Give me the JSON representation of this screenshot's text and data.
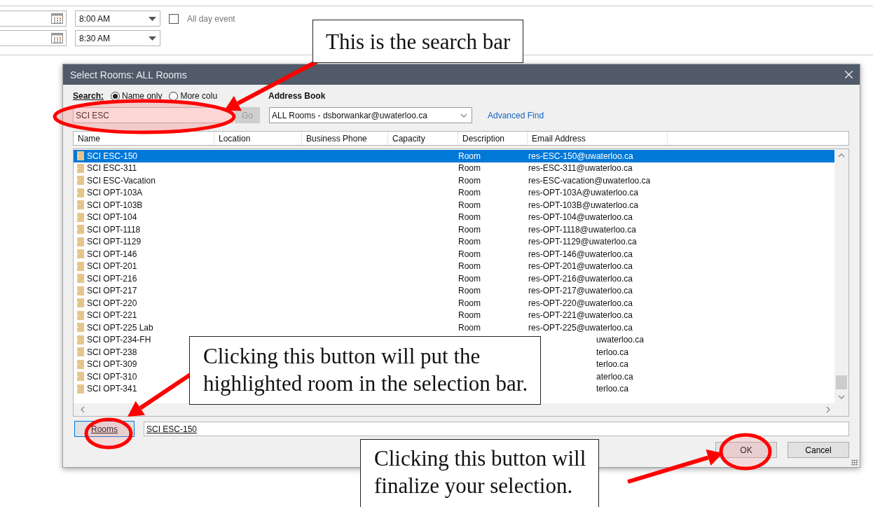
{
  "appointment": {
    "rows": [
      {
        "time": "8:00 AM",
        "all_day": {
          "label": "All day event",
          "checked": false
        }
      },
      {
        "time": "8:30 AM"
      }
    ]
  },
  "dialog": {
    "title": "Select Rooms: ALL Rooms",
    "search_label": "Search:",
    "search_modes": [
      {
        "label": "Name only",
        "selected": true
      },
      {
        "label": "More colu",
        "selected": false
      }
    ],
    "search_field": {
      "value": "SCI ESC"
    },
    "go_button": {
      "label": "Go",
      "disabled": true
    },
    "address_book": {
      "label": "Address Book",
      "value": "ALL Rooms - dsborwankar@uwaterloo.ca"
    },
    "advanced_find": "Advanced Find",
    "table": {
      "columns": [
        "Name",
        "Location",
        "Business Phone",
        "Capacity",
        "Description",
        "Email Address"
      ],
      "rows": [
        {
          "name": "SCI ESC-150",
          "description": "Room",
          "email": "res-ESC-150@uwaterloo.ca",
          "selected": true,
          "kind": "full"
        },
        {
          "name": "SCI ESC-311",
          "description": "Room",
          "email": "res-ESC-311@uwaterloo.ca",
          "selected": false,
          "kind": "full"
        },
        {
          "name": "SCI ESC-Vacation",
          "description": "Room",
          "email": "res-ESC-vacation@uwaterloo.ca",
          "selected": false,
          "kind": "full"
        },
        {
          "name": "SCI OPT-103A",
          "description": "Room",
          "email": "res-OPT-103A@uwaterloo.ca",
          "selected": false,
          "kind": "full"
        },
        {
          "name": "SCI OPT-103B",
          "description": "Room",
          "email": "res-OPT-103B@uwaterloo.ca",
          "selected": false,
          "kind": "full"
        },
        {
          "name": "SCI OPT-104",
          "description": "Room",
          "email": "res-OPT-104@uwaterloo.ca",
          "selected": false,
          "kind": "full"
        },
        {
          "name": "SCI OPT-1118",
          "description": "Room",
          "email": "res-OPT-1118@uwaterloo.ca",
          "selected": false,
          "kind": "full"
        },
        {
          "name": "SCI OPT-1129",
          "description": "Room",
          "email": "res-OPT-1129@uwaterloo.ca",
          "selected": false,
          "kind": "full"
        },
        {
          "name": "SCI OPT-146",
          "description": "Room",
          "email": "res-OPT-146@uwaterloo.ca",
          "selected": false,
          "kind": "full"
        },
        {
          "name": "SCI OPT-201",
          "description": "Room",
          "email": "res-OPT-201@uwaterloo.ca",
          "selected": false,
          "kind": "full"
        },
        {
          "name": "SCI OPT-216",
          "description": "Room",
          "email": "res-OPT-216@uwaterloo.ca",
          "selected": false,
          "kind": "full"
        },
        {
          "name": "SCI OPT-217",
          "description": "Room",
          "email": "res-OPT-217@uwaterloo.ca",
          "selected": false,
          "kind": "full"
        },
        {
          "name": "SCI OPT-220",
          "description": "Room",
          "email": "res-OPT-220@uwaterloo.ca",
          "selected": false,
          "kind": "full"
        },
        {
          "name": "SCI OPT-221",
          "description": "Room",
          "email": "res-OPT-221@uwaterloo.ca",
          "selected": false,
          "kind": "full"
        },
        {
          "name": "SCI OPT-225 Lab",
          "description": "Room",
          "email": "res-OPT-225@uwaterloo.ca",
          "selected": false,
          "kind": "full"
        },
        {
          "name": "SCI OPT-234-FH",
          "email": "uwaterloo.ca",
          "selected": false,
          "kind": "covered"
        },
        {
          "name": "SCI OPT-238",
          "email": "terloo.ca",
          "selected": false,
          "kind": "covered"
        },
        {
          "name": "SCI OPT-309",
          "email": "terloo.ca",
          "selected": false,
          "kind": "covered"
        },
        {
          "name": "SCI OPT-310",
          "email": "aterloo.ca",
          "selected": false,
          "kind": "covered"
        },
        {
          "name": "SCI OPT-341",
          "email": "terloo.ca",
          "selected": false,
          "kind": "covered"
        }
      ]
    },
    "rooms_button": "Rooms",
    "selection_field": {
      "value": "SCI ESC-150"
    },
    "buttons": [
      "OK",
      "Cancel"
    ]
  },
  "annotations": [
    {
      "kind": "search",
      "lines": [
        "This is the search bar"
      ]
    },
    {
      "kind": "rooms",
      "lines": [
        "Clicking this button will put the",
        "highlighted room in the selection bar."
      ]
    },
    {
      "kind": "ok",
      "lines": [
        "Clicking this button will",
        "finalize your selection."
      ]
    }
  ]
}
